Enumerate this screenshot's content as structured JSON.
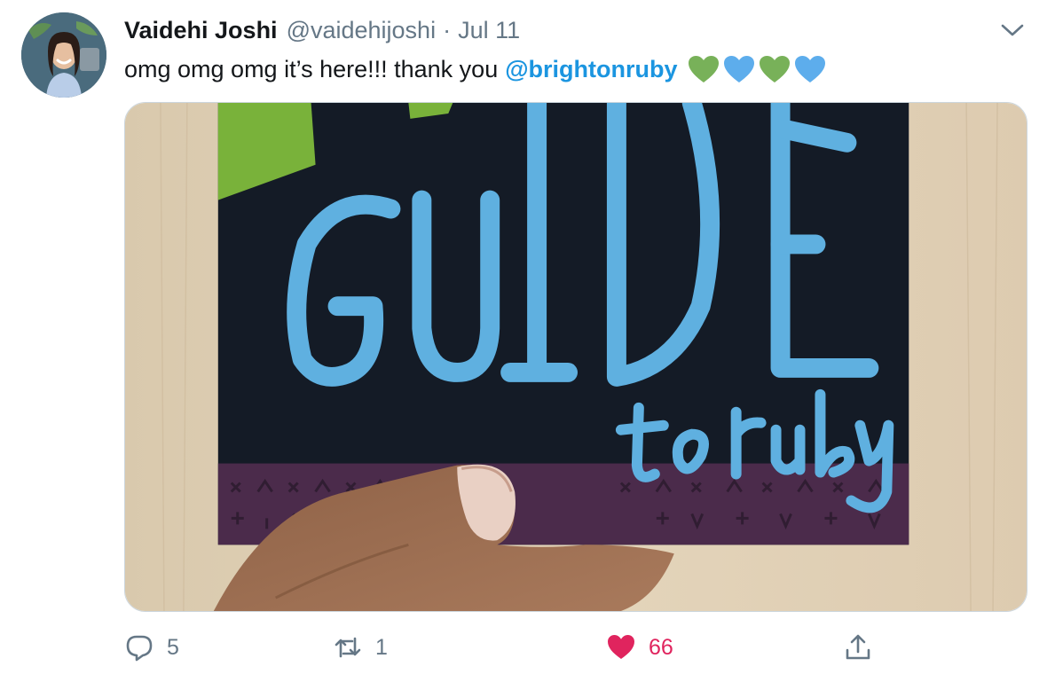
{
  "author": {
    "display_name": "Vaidehi Joshi",
    "handle": "@vaidehijoshi",
    "separator": "·",
    "date": "Jul 11"
  },
  "tweet": {
    "text": "omg omg omg it’s here!!! thank you",
    "mention": "@brightonruby",
    "hearts": [
      {
        "icon": "green-heart-icon",
        "color": "#78b159"
      },
      {
        "icon": "blue-heart-icon",
        "color": "#5dadec"
      },
      {
        "icon": "green-heart-icon",
        "color": "#78b159"
      },
      {
        "icon": "blue-heart-icon",
        "color": "#5dadec"
      }
    ]
  },
  "media": {
    "book_cover_text": {
      "title": "GUIDE",
      "subtitle": "to ruby"
    }
  },
  "actions": {
    "reply_count": "5",
    "retweet_count": "1",
    "like_count": "66",
    "like_color": "#e0245e",
    "icons": [
      "reply-icon",
      "retweet-icon",
      "like-heart-icon",
      "share-icon"
    ]
  },
  "colors": {
    "name": "#14171a",
    "secondary": "#657786",
    "link": "#1b95e0"
  }
}
